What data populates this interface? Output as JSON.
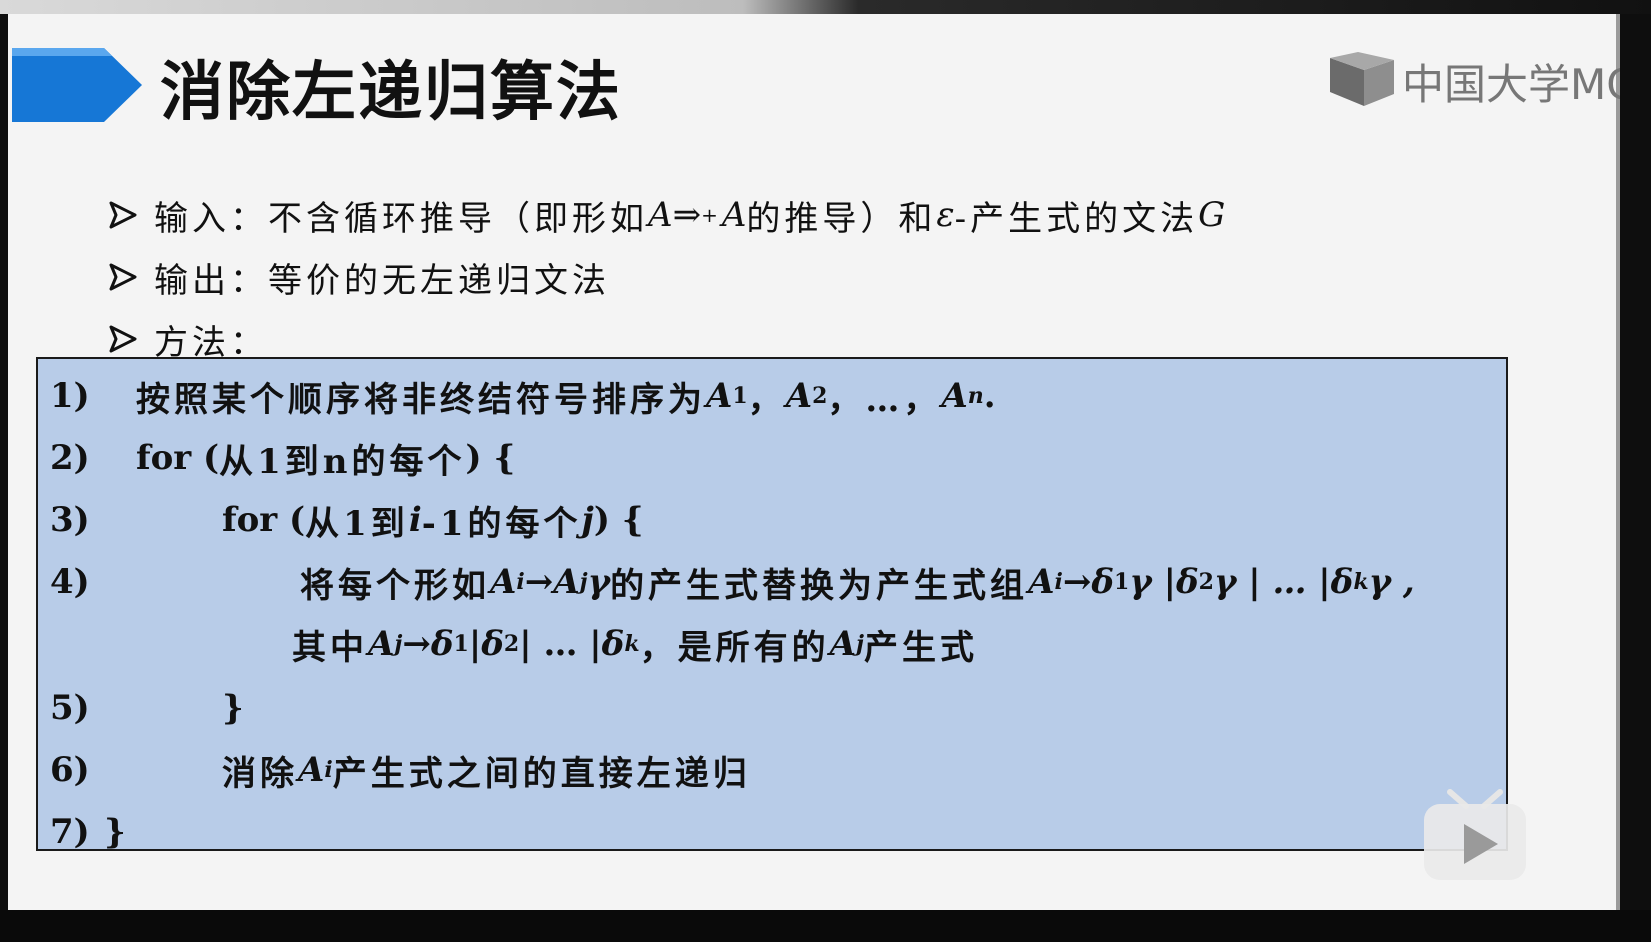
{
  "slide": {
    "title": "消除左递归算法",
    "brand": "中国大学MC",
    "bullets": {
      "input_label": "输入：",
      "input_text_1": "不含循环推导（即形如",
      "input_A1": "A",
      "input_arrow": "⇒",
      "input_plus": "+",
      "input_A2": "A",
      "input_text_2": "的推导）和",
      "input_eps": "ε",
      "input_text_3": "-产生式的文法",
      "input_G": "G",
      "output_label": "输出：",
      "output_text": "等价的无左递归文法",
      "method_label": "方法："
    },
    "algorithm": {
      "l1_num": "1)",
      "l1_text": "按照某个顺序将非终结符号排序为",
      "l1_A1": "A",
      "l1_s1": "1",
      "l1_sep1": "，",
      "l1_A2": "A",
      "l1_s2": "2",
      "l1_sep2": "，…，",
      "l1_An": "A",
      "l1_sn": "n",
      "l1_end": " .",
      "l2_num": "2)",
      "l2_for": "for ( ",
      "l2_text": "从1到n的每个",
      "l2_end": ") {",
      "l3_num": "3)",
      "l3_for": "for ( ",
      "l3_text1": "从1到",
      "l3_i": "i",
      "l3_text2": " -1的每个",
      "l3_j": "j",
      "l3_end": ") {",
      "l4_num": "4)",
      "l4_text1": "将每个形如",
      "l4_expr1": "A",
      "l4_si": "i",
      "l4_arrow1": " → ",
      "l4_Aj": "A",
      "l4_sj": "j",
      "l4_gamma": " γ",
      "l4_text2": "的产生式替换为产生式组 ",
      "l4_rhs_Ai": "A",
      "l4_rhs_si": "i",
      "l4_rhs_arrow": " → ",
      "l4_d": "δ",
      "l4_d1": "1",
      "l4_g1": " γ | ",
      "l4_d2sym": "δ",
      "l4_d2": "2",
      "l4_g2": " γ | … | ",
      "l4_dksym": "δ",
      "l4_dk": "k",
      "l4_g3": " γ ,",
      "l4b_text1": "其中",
      "l4b_Aj": "A",
      "l4b_sj": "j",
      "l4b_arrow": " → ",
      "l4b_d": "δ",
      "l4b_d1": "1",
      "l4b_bar1": " | ",
      "l4b_d2sym": "δ",
      "l4b_d2": "2",
      "l4b_bar2": " | … | ",
      "l4b_dksym": "δ",
      "l4b_dk": "k",
      "l4b_text2": "，是所有的",
      "l4b_Aj2": "A",
      "l4b_sj2": "j",
      "l4b_text3": "产生式",
      "l5_num": "5)",
      "l5_text": "}",
      "l6_num": "6)",
      "l6_text1": "消除",
      "l6_A": "A",
      "l6_si": "i",
      "l6_text2": "产生式之间的直接左递归",
      "l7_num": "7)",
      "l7_text": "}"
    }
  },
  "colors": {
    "title_arrow": "#1677d6",
    "algo_bg": "#b8cce8",
    "slide_bg": "#f4f4f4",
    "brand_gray": "#777777"
  },
  "icons": {
    "title_arrow": "chevron-banner-icon",
    "bullet": "arrowhead-bullet-icon",
    "brand": "book-logo-icon",
    "player": "play-button-icon"
  }
}
